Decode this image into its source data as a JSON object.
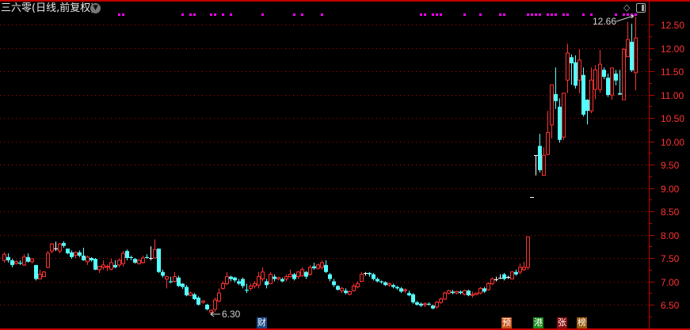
{
  "header": {
    "title": "三六零(日线,前复权)",
    "menu_icon": "chevron-down-circle-icon",
    "diamond_icon": "diamond-icon",
    "panel_icon": "panel-toggle-icon"
  },
  "colors": {
    "up": "#ff3232",
    "down": "#54ffff",
    "flat": "#ffffff",
    "grid": "#c00000",
    "marker": "#ff00ff"
  },
  "annotations": {
    "high_label": "12.66",
    "low_label": "6.30"
  },
  "events": [
    {
      "label": "财",
      "color": "#1c4a86"
    },
    {
      "label": "预",
      "color": "#c8561c"
    },
    {
      "label": "港",
      "color": "#1a8a1a"
    },
    {
      "label": "张",
      "color": "#8a1010"
    },
    {
      "label": "榜",
      "color": "#9a5a10"
    }
  ],
  "chart_data": {
    "type": "candlestick",
    "title": "三六零(日线,前复权)",
    "ylim": [
      6.3,
      12.8
    ],
    "yticks": [
      "12.50",
      "12.00",
      "11.50",
      "11.00",
      "10.50",
      "10.00",
      "9.50",
      "9.00",
      "8.50",
      "8.00",
      "7.50",
      "7.00",
      "6.50"
    ],
    "grid": true,
    "ohlc_format": [
      "open",
      "close",
      "high",
      "low"
    ],
    "candles": [
      [
        7.45,
        7.58,
        7.62,
        7.4
      ],
      [
        7.52,
        7.45,
        7.6,
        7.4
      ],
      [
        7.45,
        7.35,
        7.48,
        7.3
      ],
      [
        7.38,
        7.42,
        7.45,
        7.36
      ],
      [
        7.4,
        7.38,
        7.45,
        7.35
      ],
      [
        7.35,
        7.52,
        7.58,
        7.33
      ],
      [
        7.52,
        7.42,
        7.6,
        7.4
      ],
      [
        7.42,
        7.48,
        7.5,
        7.38
      ],
      [
        7.35,
        7.05,
        7.35,
        7.02
      ],
      [
        7.05,
        7.15,
        7.25,
        7.05
      ],
      [
        7.1,
        7.2,
        7.22,
        7.1
      ],
      [
        7.3,
        7.6,
        7.65,
        7.28
      ],
      [
        7.65,
        7.8,
        7.82,
        7.6
      ],
      [
        7.7,
        7.7,
        7.85,
        7.65
      ],
      [
        7.65,
        7.8,
        7.82,
        7.6
      ],
      [
        7.82,
        7.76,
        7.86,
        7.72
      ],
      [
        7.7,
        7.6,
        7.7,
        7.58
      ],
      [
        7.62,
        7.52,
        7.66,
        7.48
      ],
      [
        7.56,
        7.62,
        7.64,
        7.5
      ],
      [
        7.62,
        7.55,
        7.66,
        7.52
      ],
      [
        7.55,
        7.45,
        7.72,
        7.44
      ],
      [
        7.42,
        7.52,
        7.55,
        7.35
      ],
      [
        7.5,
        7.45,
        7.52,
        7.42
      ],
      [
        7.48,
        7.25,
        7.5,
        7.24
      ],
      [
        7.25,
        7.32,
        7.33,
        7.18
      ],
      [
        7.3,
        7.35,
        7.45,
        7.25
      ],
      [
        7.3,
        7.32,
        7.36,
        7.22
      ],
      [
        7.26,
        7.4,
        7.48,
        7.24
      ],
      [
        7.35,
        7.3,
        7.45,
        7.28
      ],
      [
        7.35,
        7.45,
        7.48,
        7.3
      ],
      [
        7.38,
        7.6,
        7.65,
        7.32
      ],
      [
        7.65,
        7.5,
        7.68,
        7.45
      ],
      [
        7.52,
        7.5,
        7.55,
        7.45
      ],
      [
        7.48,
        7.4,
        7.5,
        7.38
      ],
      [
        7.38,
        7.45,
        7.47,
        7.36
      ],
      [
        7.4,
        7.5,
        7.55,
        7.38
      ],
      [
        7.52,
        7.5,
        7.58,
        7.48
      ],
      [
        7.5,
        7.5,
        7.75,
        7.45
      ],
      [
        7.5,
        7.68,
        7.9,
        7.48
      ],
      [
        7.7,
        7.2,
        7.7,
        7.18
      ],
      [
        7.2,
        7.12,
        7.25,
        7.08
      ],
      [
        7.05,
        7.1,
        7.12,
        6.85
      ],
      [
        7.0,
        6.98,
        7.1,
        6.96
      ],
      [
        7.0,
        7.1,
        7.2,
        6.98
      ],
      [
        7.08,
        6.9,
        7.12,
        6.88
      ],
      [
        6.95,
        6.88,
        6.96,
        6.84
      ],
      [
        6.88,
        6.7,
        6.92,
        6.68
      ],
      [
        6.7,
        6.75,
        6.78,
        6.68
      ],
      [
        6.72,
        6.62,
        6.75,
        6.6
      ],
      [
        6.65,
        6.5,
        6.68,
        6.48
      ],
      [
        6.55,
        6.58,
        6.6,
        6.52
      ],
      [
        6.5,
        6.4,
        6.52,
        6.38
      ],
      [
        6.34,
        6.38,
        6.4,
        6.3
      ],
      [
        6.4,
        6.6,
        6.65,
        6.35
      ],
      [
        6.58,
        6.75,
        6.85,
        6.55
      ],
      [
        6.85,
        6.95,
        7.0,
        6.82
      ],
      [
        6.95,
        7.1,
        7.2,
        6.92
      ],
      [
        7.1,
        7.05,
        7.12,
        7.0
      ],
      [
        7.08,
        7.02,
        7.1,
        6.98
      ],
      [
        7.0,
        6.95,
        7.05,
        6.92
      ],
      [
        7.05,
        6.9,
        7.08,
        6.85
      ],
      [
        6.82,
        6.8,
        6.95,
        6.75
      ],
      [
        6.85,
        6.9,
        6.95,
        6.8
      ],
      [
        6.9,
        6.95,
        7.0,
        6.85
      ],
      [
        6.92,
        7.1,
        7.2,
        6.85
      ],
      [
        7.05,
        7.2,
        7.3,
        7.0
      ],
      [
        7.0,
        6.92,
        7.05,
        6.85
      ],
      [
        6.95,
        7.15,
        7.2,
        6.95
      ],
      [
        7.1,
        7.05,
        7.15,
        7.0
      ],
      [
        7.05,
        7.08,
        7.1,
        7.02
      ],
      [
        7.05,
        7.0,
        7.08,
        6.98
      ],
      [
        7.05,
        7.1,
        7.15,
        7.0
      ],
      [
        7.1,
        7.15,
        7.25,
        7.08
      ],
      [
        7.15,
        7.05,
        7.18,
        7.02
      ],
      [
        7.1,
        7.2,
        7.22,
        7.05
      ],
      [
        7.12,
        7.25,
        7.3,
        7.1
      ],
      [
        7.2,
        7.1,
        7.22,
        7.05
      ],
      [
        7.15,
        7.3,
        7.35,
        7.12
      ],
      [
        7.32,
        7.28,
        7.4,
        7.25
      ],
      [
        7.28,
        7.35,
        7.38,
        7.25
      ],
      [
        7.3,
        7.4,
        7.45,
        7.25
      ],
      [
        7.35,
        7.2,
        7.45,
        7.18
      ],
      [
        7.15,
        7.05,
        7.18,
        7.0
      ],
      [
        7.0,
        6.92,
        7.05,
        6.88
      ],
      [
        6.9,
        6.82,
        6.92,
        6.8
      ],
      [
        6.8,
        6.85,
        6.88,
        6.75
      ],
      [
        6.8,
        6.75,
        6.85,
        6.72
      ],
      [
        6.72,
        6.78,
        6.8,
        6.7
      ],
      [
        6.8,
        6.9,
        6.95,
        6.78
      ],
      [
        6.88,
        6.95,
        7.0,
        6.85
      ],
      [
        7.0,
        7.15,
        7.2,
        7.0
      ],
      [
        7.18,
        7.18,
        7.2,
        7.12
      ],
      [
        7.18,
        7.15,
        7.2,
        7.1
      ],
      [
        7.15,
        7.05,
        7.18,
        7.02
      ],
      [
        7.05,
        7.0,
        7.08,
        6.98
      ],
      [
        7.0,
        6.98,
        7.02,
        6.95
      ],
      [
        6.98,
        6.92,
        7.0,
        6.9
      ],
      [
        6.92,
        6.95,
        6.97,
        6.88
      ],
      [
        6.92,
        6.88,
        6.95,
        6.85
      ],
      [
        6.88,
        6.85,
        6.9,
        6.82
      ],
      [
        6.85,
        6.78,
        6.88,
        6.75
      ],
      [
        6.8,
        6.82,
        6.85,
        6.75
      ],
      [
        6.75,
        6.7,
        6.8,
        6.68
      ],
      [
        6.72,
        6.55,
        6.75,
        6.52
      ],
      [
        6.55,
        6.5,
        6.58,
        6.48
      ],
      [
        6.52,
        6.48,
        6.55,
        6.45
      ],
      [
        6.5,
        6.52,
        6.55,
        6.45
      ],
      [
        6.52,
        6.5,
        6.55,
        6.48
      ],
      [
        6.48,
        6.42,
        6.5,
        6.4
      ],
      [
        6.45,
        6.55,
        6.58,
        6.42
      ],
      [
        6.55,
        6.62,
        6.65,
        6.52
      ],
      [
        6.62,
        6.75,
        6.78,
        6.6
      ],
      [
        6.75,
        6.8,
        6.82,
        6.72
      ],
      [
        6.78,
        6.75,
        6.82,
        6.72
      ],
      [
        6.75,
        6.78,
        6.8,
        6.72
      ],
      [
        6.78,
        6.75,
        6.8,
        6.72
      ],
      [
        6.72,
        6.8,
        6.82,
        6.7
      ],
      [
        6.8,
        6.7,
        6.82,
        6.68
      ],
      [
        6.7,
        6.72,
        6.78,
        6.65
      ],
      [
        6.72,
        6.75,
        6.76,
        6.7
      ],
      [
        6.75,
        6.85,
        6.88,
        6.72
      ],
      [
        6.85,
        6.78,
        6.88,
        6.75
      ],
      [
        6.82,
        6.95,
        6.98,
        6.8
      ],
      [
        6.95,
        7.05,
        7.08,
        6.92
      ],
      [
        7.05,
        7.05,
        7.1,
        7.0
      ],
      [
        7.08,
        7.08,
        7.15,
        7.05
      ],
      [
        7.15,
        7.05,
        7.18,
        7.02
      ],
      [
        7.1,
        7.1,
        7.12,
        7.05
      ],
      [
        7.05,
        7.2,
        7.22,
        7.05
      ],
      [
        7.2,
        7.15,
        7.25,
        7.12
      ],
      [
        7.2,
        7.3,
        7.38,
        7.15
      ],
      [
        7.25,
        7.3,
        7.42,
        7.22
      ],
      [
        7.3,
        7.95,
        7.95,
        7.25
      ],
      [
        8.8,
        8.8,
        8.8,
        8.8
      ],
      [
        9.7,
        9.7,
        9.7,
        9.27
      ],
      [
        9.9,
        9.38,
        10.16,
        9.33
      ],
      [
        9.27,
        9.7,
        9.87,
        9.27
      ],
      [
        9.72,
        10.19,
        10.65,
        9.7
      ],
      [
        10.35,
        11.21,
        11.21,
        10.06
      ],
      [
        11.01,
        10.86,
        11.58,
        10.69
      ],
      [
        10.74,
        10.03,
        10.92,
        9.97
      ],
      [
        10.09,
        11.03,
        11.03,
        10.03
      ],
      [
        11.31,
        11.89,
        12.09,
        11.03
      ],
      [
        11.8,
        11.67,
        11.86,
        11.21
      ],
      [
        11.69,
        11.19,
        11.84,
        11.13
      ],
      [
        11.31,
        11.74,
        11.97,
        11.03
      ],
      [
        11.42,
        10.57,
        11.58,
        10.53
      ],
      [
        10.89,
        10.65,
        10.9,
        10.36
      ],
      [
        10.65,
        11.31,
        11.58,
        10.6
      ],
      [
        11.11,
        11.53,
        11.63,
        10.9
      ],
      [
        11.11,
        11.65,
        11.96,
        11.04
      ],
      [
        11.53,
        11.38,
        11.58,
        11.33
      ],
      [
        11.36,
        10.99,
        11.45,
        10.95
      ],
      [
        10.99,
        11.57,
        11.57,
        10.89
      ],
      [
        11.45,
        11.3,
        11.53,
        11.2
      ],
      [
        11.03,
        11.0,
        11.53,
        10.99
      ],
      [
        10.89,
        11.97,
        12.0,
        10.89
      ],
      [
        11.81,
        12.18,
        12.55,
        11.81
      ],
      [
        12.13,
        11.52,
        12.52,
        11.48
      ],
      [
        11.47,
        12.21,
        12.66,
        11.09
      ]
    ],
    "signal_markers": [
      29,
      30,
      45,
      47,
      48,
      52,
      53,
      55,
      57,
      65,
      73,
      75,
      80,
      105,
      106,
      108,
      109,
      110,
      116,
      120,
      125,
      126,
      132,
      133,
      134,
      135,
      137,
      138,
      139,
      141,
      142,
      146,
      148,
      154,
      156,
      157,
      158,
      159
    ],
    "high": {
      "value": 12.66,
      "label": "12.66"
    },
    "low": {
      "value": 6.3,
      "label": "6.30"
    }
  }
}
